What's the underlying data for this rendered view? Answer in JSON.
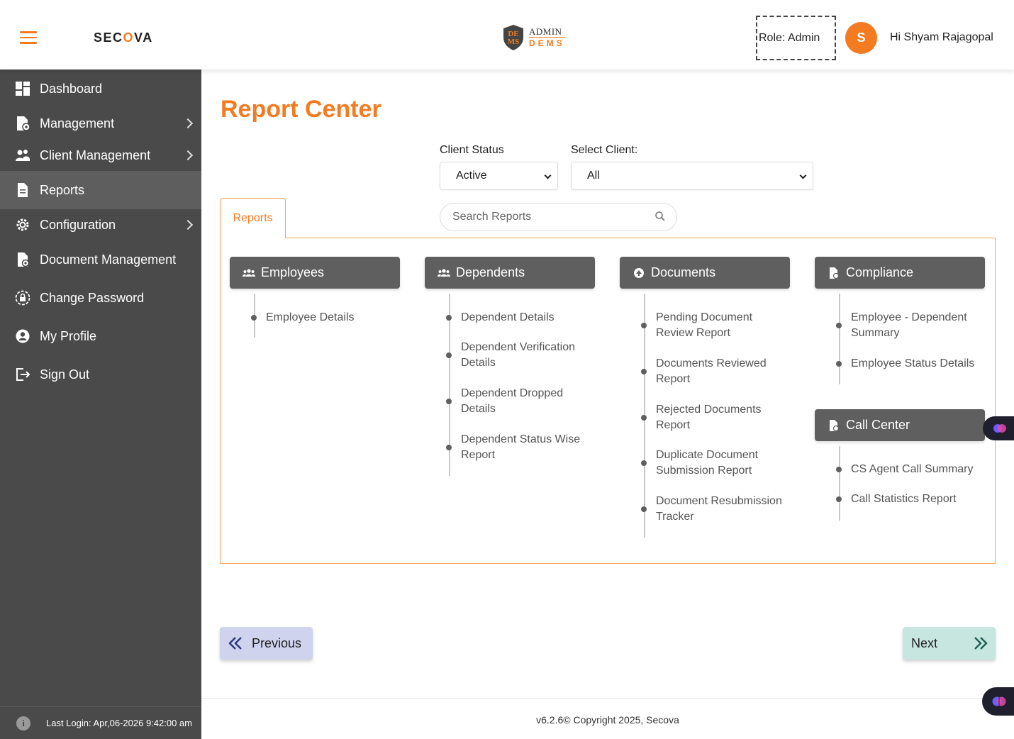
{
  "header": {
    "brand": {
      "pre": "SEC",
      "accent": "O",
      "post": "VA"
    },
    "app_logo": {
      "badge_line1": "DE",
      "badge_line2": "MS",
      "line1": "ADMIN",
      "line2": "DEMS"
    },
    "role": "Role: Admin",
    "avatar_initial": "S",
    "greeting": "Hi Shyam Rajagopal"
  },
  "sidebar": {
    "items": [
      {
        "label": "Dashboard",
        "icon": "dashboard-icon",
        "has_submenu": false,
        "active": false
      },
      {
        "label": "Management",
        "icon": "management-icon",
        "has_submenu": true,
        "active": false
      },
      {
        "label": "Client Management",
        "icon": "client-management-icon",
        "has_submenu": true,
        "active": false
      },
      {
        "label": "Reports",
        "icon": "reports-icon",
        "has_submenu": false,
        "active": true
      },
      {
        "label": "Configuration",
        "icon": "configuration-icon",
        "has_submenu": true,
        "active": false
      },
      {
        "label": "Document Management",
        "icon": "document-management-icon",
        "has_submenu": false,
        "active": false
      },
      {
        "label": "Change Password",
        "icon": "lock-icon",
        "has_submenu": false,
        "active": false
      },
      {
        "label": "My Profile",
        "icon": "user-icon",
        "has_submenu": false,
        "active": false
      },
      {
        "label": "Sign Out",
        "icon": "sign-out-icon",
        "has_submenu": false,
        "active": false
      }
    ],
    "last_login": "Last Login: Apr,06-2026 9:42:00 am"
  },
  "main": {
    "title": "Report Center",
    "filters": {
      "client_status_label": "Client Status",
      "client_status_value": "Active",
      "select_client_label": "Select Client:",
      "select_client_value": "All"
    },
    "tab_label": "Reports",
    "search_placeholder": "Search Reports",
    "categories": [
      {
        "title": "Employees",
        "icon": "users-icon",
        "items": [
          "Employee Details"
        ]
      },
      {
        "title": "Dependents",
        "icon": "users-icon",
        "items": [
          "Dependent Details",
          "Dependent Verification Details",
          "Dependent Dropped Details",
          "Dependent Status Wise Report"
        ]
      },
      {
        "title": "Documents",
        "icon": "documents-icon",
        "items": [
          "Pending Document Review Report",
          "Documents Reviewed Report",
          "Rejected Documents Report",
          "Duplicate Document Submission Report",
          "Document Resubmission Tracker"
        ]
      },
      {
        "title": "Compliance",
        "icon": "compliance-icon",
        "items": [
          "Employee - Dependent Summary",
          "Employee Status Details"
        ]
      },
      {
        "title": "Call Center",
        "icon": "call-center-icon",
        "items": [
          "CS Agent Call Summary",
          "Call Statistics Report"
        ]
      }
    ],
    "prev_label": "Previous",
    "next_label": "Next"
  },
  "footer": {
    "copyright": "v6.2.6© Copyright 2025, Secova"
  },
  "colors": {
    "accent": "#f47b20",
    "sidebar_bg": "#4a4a4a",
    "card_header": "#5f5f5f",
    "prev_bg": "#cfd3ee",
    "next_bg": "#c7e6e0"
  }
}
